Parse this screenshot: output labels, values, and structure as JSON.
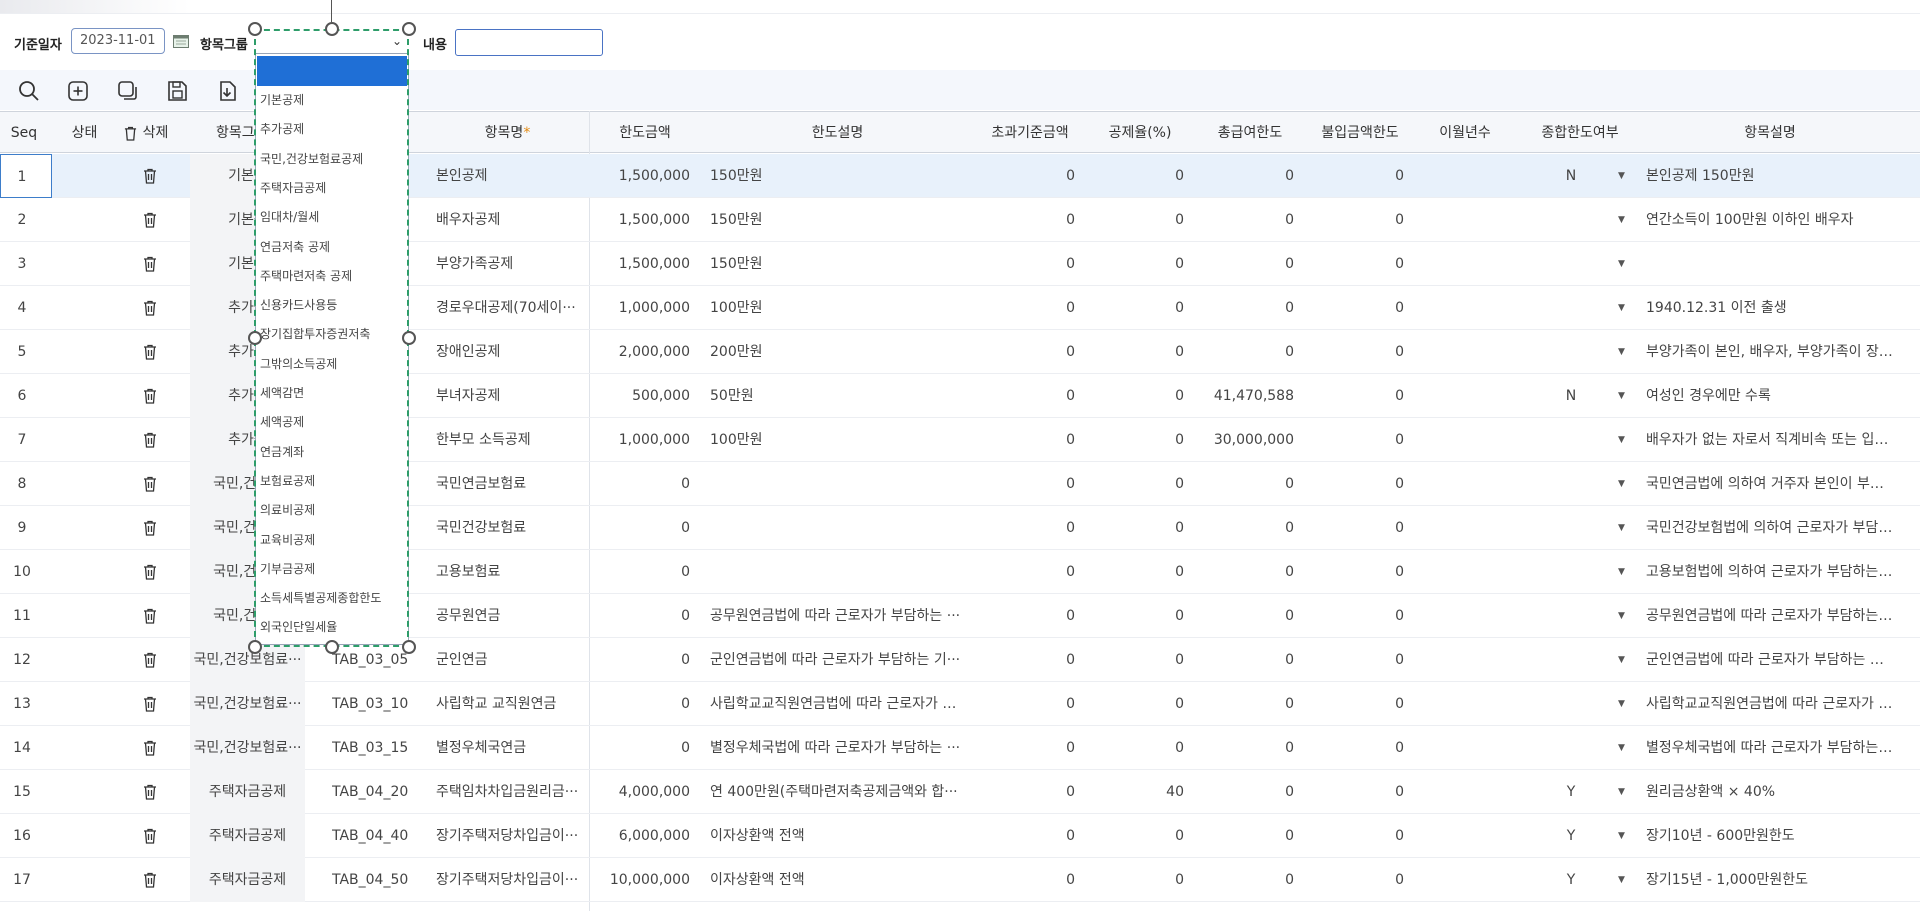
{
  "filters": {
    "base_date_label": "기준일자",
    "base_date_value": "2023-11-01",
    "item_group_label": "항목그룹",
    "content_label": "내용",
    "content_value": ""
  },
  "toolbar": [
    "search-icon",
    "add-icon",
    "copy-icon",
    "save-icon",
    "download-icon"
  ],
  "columns": {
    "seq": "Seq",
    "status": "상태",
    "delete": "삭제",
    "group": "항목그",
    "name": "항목명",
    "required_mark": "*",
    "limit_amount": "한도금액",
    "limit_desc": "한도설명",
    "excess_base": "초과기준금액",
    "deduction_rate": "공제율(%)",
    "total_salary_limit": "총급여한도",
    "non_payment_limit": "불입금액한도",
    "carryover_years": "이월년수",
    "combined_limit": "종합한도여부",
    "item_desc": "항목설명"
  },
  "dropdown_items": [
    "기본공제",
    "추가공제",
    "국민,건강보험료공제",
    "주택자금공제",
    "임대차/월세",
    "연금저축 공제",
    "주택마련저축 공제",
    "신용카드사용등",
    "장기집합투자증권저축",
    "그밖의소득공제",
    "세액감면",
    "세액공제",
    "연금계좌",
    "보험료공제",
    "의료비공제",
    "교육비공제",
    "기부금공제",
    "소득세특별공제종합한도",
    "외국인단일세율"
  ],
  "rows": [
    {
      "seq": "1",
      "group": "기본공",
      "code": "",
      "name": "본인공제",
      "limit": "1,500,000",
      "limit_desc": "150만원",
      "excess": "0",
      "rate": "0",
      "salary": "0",
      "nonpay": "0",
      "combined": "N",
      "desc": "본인공제 150만원"
    },
    {
      "seq": "2",
      "group": "기본공",
      "code": "",
      "name": "배우자공제",
      "limit": "1,500,000",
      "limit_desc": "150만원",
      "excess": "0",
      "rate": "0",
      "salary": "0",
      "nonpay": "0",
      "combined": "",
      "desc": "연간소득이 100만원 이하인 배우자"
    },
    {
      "seq": "3",
      "group": "기본공",
      "code": "",
      "name": "부양가족공제",
      "limit": "1,500,000",
      "limit_desc": "150만원",
      "excess": "0",
      "rate": "0",
      "salary": "0",
      "nonpay": "0",
      "combined": "",
      "desc": ""
    },
    {
      "seq": "4",
      "group": "추가공",
      "code": "",
      "name": "경로우대공제(70세이···",
      "limit": "1,000,000",
      "limit_desc": "100만원",
      "excess": "0",
      "rate": "0",
      "salary": "0",
      "nonpay": "0",
      "combined": "",
      "desc": "1940.12.31 이전 출생"
    },
    {
      "seq": "5",
      "group": "추가공",
      "code": "",
      "name": "장애인공제",
      "limit": "2,000,000",
      "limit_desc": "200만원",
      "excess": "0",
      "rate": "0",
      "salary": "0",
      "nonpay": "0",
      "combined": "",
      "desc": "부양가족이 본인, 배우자, 부양가족이 장애···"
    },
    {
      "seq": "6",
      "group": "추가공",
      "code": "",
      "name": "부녀자공제",
      "limit": "500,000",
      "limit_desc": "50만원",
      "excess": "0",
      "rate": "0",
      "salary": "41,470,588",
      "nonpay": "0",
      "combined": "N",
      "desc": "여성인 경우에만 수록"
    },
    {
      "seq": "7",
      "group": "추가공",
      "code": "",
      "name": "한부모 소득공제",
      "limit": "1,000,000",
      "limit_desc": "100만원",
      "excess": "0",
      "rate": "0",
      "salary": "30,000,000",
      "nonpay": "0",
      "combined": "",
      "desc": "배우자가 없는 자로서 직계비속 또는 입양···"
    },
    {
      "seq": "8",
      "group": "국민,건강보",
      "code": "",
      "name": "국민연금보험료",
      "limit": "0",
      "limit_desc": "",
      "excess": "0",
      "rate": "0",
      "salary": "0",
      "nonpay": "0",
      "combined": "",
      "desc": "국민연금법에 의하여 거주자 본인이 부담···"
    },
    {
      "seq": "9",
      "group": "국민,건강보",
      "code": "",
      "name": "국민건강보험료",
      "limit": "0",
      "limit_desc": "",
      "excess": "0",
      "rate": "0",
      "salary": "0",
      "nonpay": "0",
      "combined": "",
      "desc": "국민건강보험법에 의하여 근로자가 부담하···"
    },
    {
      "seq": "10",
      "group": "국민,건강보",
      "code": "",
      "name": "고용보험료",
      "limit": "0",
      "limit_desc": "",
      "excess": "0",
      "rate": "0",
      "salary": "0",
      "nonpay": "0",
      "combined": "",
      "desc": "고용보험법에 의하여 근로자가 부담하는 ···"
    },
    {
      "seq": "11",
      "group": "국민,건강보",
      "code": "",
      "name": "공무원연금",
      "limit": "0",
      "limit_desc": "공무원연금법에 따라 근로자가 부담하는 ···",
      "excess": "0",
      "rate": "0",
      "salary": "0",
      "nonpay": "0",
      "combined": "",
      "desc": "공무원연금법에 따라 근로자가 부담하는 ···"
    },
    {
      "seq": "12",
      "group": "국민,건강보험료···",
      "code": "TAB_03_05",
      "name": "군인연금",
      "limit": "0",
      "limit_desc": "군인연금법에 따라 근로자가 부담하는 기···",
      "excess": "0",
      "rate": "0",
      "salary": "0",
      "nonpay": "0",
      "combined": "",
      "desc": "군인연금법에 따라 근로자가 부담하는 기···"
    },
    {
      "seq": "13",
      "group": "국민,건강보험료···",
      "code": "TAB_03_10",
      "name": "사립학교 교직원연금",
      "limit": "0",
      "limit_desc": "사립학교교직원연금법에 따라 근로자가 부···",
      "excess": "0",
      "rate": "0",
      "salary": "0",
      "nonpay": "0",
      "combined": "",
      "desc": "사립학교교직원연금법에 따라 근로자가 부···"
    },
    {
      "seq": "14",
      "group": "국민,건강보험료···",
      "code": "TAB_03_15",
      "name": "별정우체국연금",
      "limit": "0",
      "limit_desc": "별정우체국법에 따라 근로자가 부담하는 ···",
      "excess": "0",
      "rate": "0",
      "salary": "0",
      "nonpay": "0",
      "combined": "",
      "desc": "별정우체국법에 따라 근로자가 부담하는 ···"
    },
    {
      "seq": "15",
      "group": "주택자금공제",
      "code": "TAB_04_20",
      "name": "주택임차차입금원리금···",
      "limit": "4,000,000",
      "limit_desc": "연 400만원(주택마련저축공제금액와 합···",
      "excess": "0",
      "rate": "40",
      "salary": "0",
      "nonpay": "0",
      "combined": "Y",
      "desc": "원리금상환액 × 40%"
    },
    {
      "seq": "16",
      "group": "주택자금공제",
      "code": "TAB_04_40",
      "name": "장기주택저당차입금이···",
      "limit": "6,000,000",
      "limit_desc": "이자상환액 전액",
      "excess": "0",
      "rate": "0",
      "salary": "0",
      "nonpay": "0",
      "combined": "Y",
      "desc": "장기10년 - 600만원한도"
    },
    {
      "seq": "17",
      "group": "주택자금공제",
      "code": "TAB_04_50",
      "name": "장기주택저당차입금이···",
      "limit": "10,000,000",
      "limit_desc": "이자상환액 전액",
      "excess": "0",
      "rate": "0",
      "salary": "0",
      "nonpay": "0",
      "combined": "Y",
      "desc": "장기15년 - 1,000만원한도"
    }
  ],
  "colors": {
    "accent": "#1f6fd6",
    "selection_border": "#2e9d6a",
    "required_star": "#e48a10",
    "selected_row": "#e8f1fb"
  }
}
